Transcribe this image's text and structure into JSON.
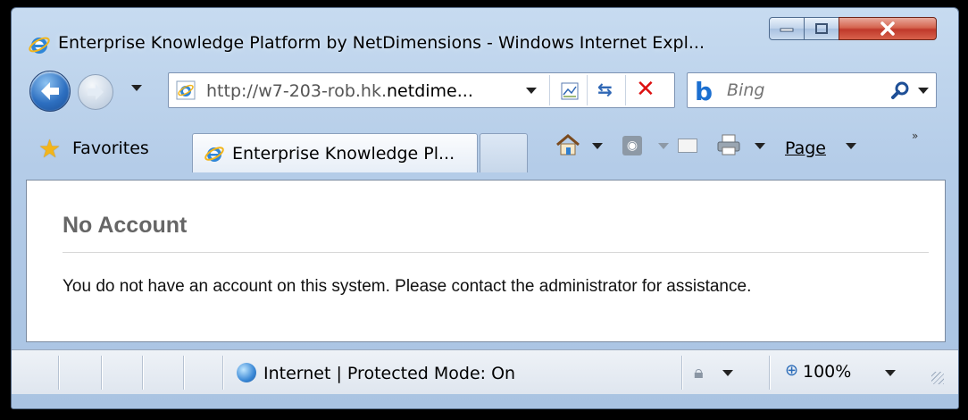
{
  "window": {
    "title": "Enterprise Knowledge Platform by NetDimensions - Windows Internet Expl..."
  },
  "address": {
    "url_prefix": "http://w7-203-rob.hk.",
    "url_domain": "netdime..."
  },
  "search": {
    "placeholder": "Bing"
  },
  "commandbar": {
    "favorites_label": "Favorites",
    "tab_label": "Enterprise Knowledge Pl...",
    "page_menu_label": "Page"
  },
  "content": {
    "heading": "No Account",
    "message": "You do not have an account on this system. Please contact the administrator for assistance."
  },
  "status": {
    "zone": "Internet | Protected Mode: On",
    "zoom": "100%"
  },
  "icons": {
    "ie": "internet-explorer-icon",
    "back": "back-arrow-icon",
    "forward": "forward-arrow-icon",
    "refresh": "refresh-icon",
    "stop": "stop-icon",
    "search": "magnifier-icon",
    "favorites": "star-icon",
    "home": "home-icon",
    "feeds": "rss-feed-icon",
    "mail": "mail-icon",
    "print": "printer-icon",
    "globe": "globe-icon",
    "zoom": "zoom-icon"
  },
  "colors": {
    "frame": "#b4cce8",
    "close_button": "#c0392b",
    "heading_text": "#666666",
    "bing_blue": "#1b6fd0"
  }
}
